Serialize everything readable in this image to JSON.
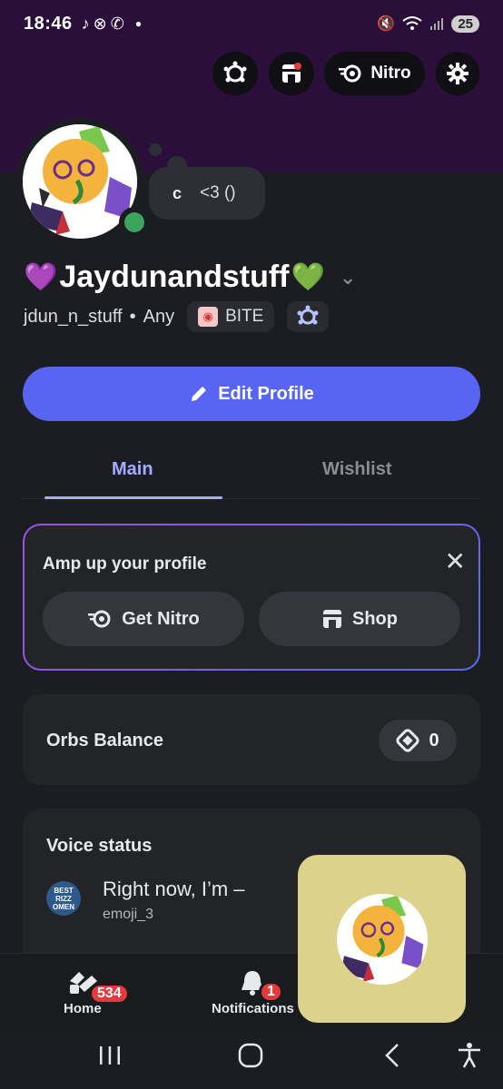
{
  "status_bar": {
    "time": "18:46",
    "battery": "25",
    "app_icons": [
      "tiktok-icon",
      "xbox-icon",
      "whatsapp-icon",
      "dot-icon"
    ],
    "system_icons": [
      "mute-icon",
      "wifi-icon",
      "signal-icon"
    ]
  },
  "top_actions": {
    "nitro_label": "Nitro"
  },
  "profile": {
    "custom_status_prefix": "c",
    "custom_status": "<3 ()",
    "display_name": "Jaydunandstuff",
    "heart_left": "💜",
    "heart_right": "💚",
    "username": "jdun_n_stuff",
    "pronoun_sep": "•",
    "pronouns": "Any",
    "guild_tag": "BITE"
  },
  "edit_profile_label": "Edit Profile",
  "tabs": [
    {
      "label": "Main",
      "active": true
    },
    {
      "label": "Wishlist",
      "active": false
    }
  ],
  "amp_card": {
    "title": "Amp up your profile",
    "get_nitro_label": "Get Nitro",
    "shop_label": "Shop"
  },
  "orbs": {
    "label": "Orbs Balance",
    "value": "0"
  },
  "voice_status": {
    "title": "Voice status",
    "main": "Right now, I’m –",
    "sub": "emoji_3",
    "avatar_text": "BEST RIZZ OMEN"
  },
  "bottom_nav": {
    "home_label": "Home",
    "home_badge": "534",
    "notifications_label": "Notifications",
    "notifications_badge": "1"
  },
  "colors": {
    "accent": "#5865f2",
    "banner": "#2a0f3a",
    "online": "#3ba55d",
    "badge": "#e5393b",
    "tab_active": "#a5abff"
  }
}
